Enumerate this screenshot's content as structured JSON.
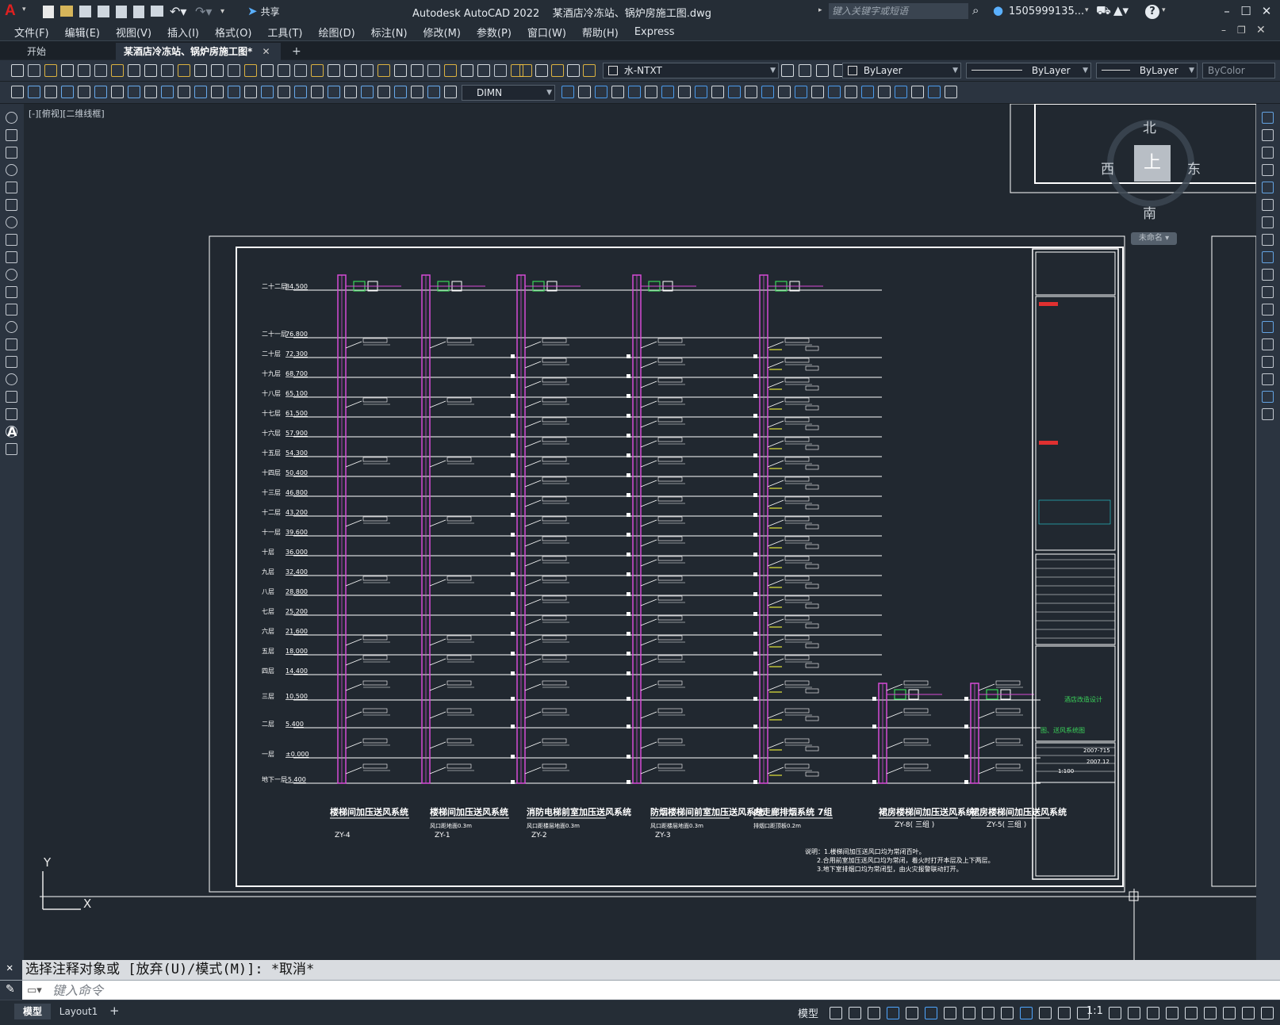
{
  "app": {
    "logo": "A",
    "share_label": "共享",
    "title": "Autodesk AutoCAD 2022    某酒店冷冻站、锅炉房施工图.dwg",
    "search_placeholder": "键入关键字或短语",
    "user": "1505999135...",
    "help": "?"
  },
  "menu": [
    "文件(F)",
    "编辑(E)",
    "视图(V)",
    "插入(I)",
    "格式(O)",
    "工具(T)",
    "绘图(D)",
    "标注(N)",
    "修改(M)",
    "参数(P)",
    "窗口(W)",
    "帮助(H)",
    "Express"
  ],
  "tabs": {
    "start": "开始",
    "active": "某酒店冷冻站、锅炉房施工图*",
    "close": "✕",
    "add": "+"
  },
  "toolbar": {
    "layer": "水-NTXT",
    "color": "ByLayer",
    "linetype": "ByLayer",
    "lineweight": "ByLayer",
    "plotstyle": "ByColor",
    "dimstyle": "DIMN"
  },
  "viewport": {
    "label": "[-][俯视][二维线框]"
  },
  "viewcube": {
    "north": "北",
    "south": "南",
    "east": "东",
    "west": "西",
    "top": "上",
    "wcs": "未命名"
  },
  "drawing": {
    "floors": [
      "二十二层",
      "二十一层",
      "二十层",
      "十九层",
      "十八层",
      "十七层",
      "十六层",
      "十五层",
      "十四层",
      "十三层",
      "十二层",
      "十一层",
      "十层",
      "九层",
      "八层",
      "七层",
      "六层",
      "五层",
      "四层",
      "三层",
      "二层",
      "一层",
      "地下一层"
    ],
    "elevations": [
      "84.500",
      "76.800",
      "72.300",
      "68.700",
      "65.100",
      "61.500",
      "57.900",
      "54.300",
      "50.400",
      "46.800",
      "43.200",
      "39.600",
      "36.000",
      "32.400",
      "28.800",
      "25.200",
      "21.600",
      "18.000",
      "14.400",
      "10.500",
      "5.400",
      "±0.000",
      "-5.400"
    ],
    "systems": [
      {
        "title": "楼梯间加压送风系统",
        "code": "ZY-4",
        "sub": ""
      },
      {
        "title": "楼梯间加压送风系统",
        "code": "ZY-1",
        "sub": "风口距地面0.3m"
      },
      {
        "title": "消防电梯前室加压送风系统",
        "code": "ZY-2",
        "sub": "风口距楼层地面0.3m"
      },
      {
        "title": "防烟楼梯间前室加压送风系统",
        "code": "ZY-3",
        "sub": "风口距楼层地面0.3m"
      },
      {
        "title": "内走廊排烟系统 7组",
        "code": "",
        "sub": "排烟口距顶板0.2m"
      },
      {
        "title": "裙房楼梯间加压送风系统",
        "code": "ZY-8( 三组 )",
        "sub": ""
      },
      {
        "title": "裙房楼梯间加压送风系统",
        "code": "ZY-5( 三组 )",
        "sub": ""
      }
    ],
    "notes": [
      "说明：1.楼梯间加压送风口均为常闭百叶。",
      "2.合用前室加压送风口均为常闭，着火时打开本层及上下两层。",
      "3.地下室排烟口均为常闭型，由火灾报警联动打开。"
    ],
    "titleblock": {
      "project": "酒店改造设计",
      "drawing": "图、送风系统图",
      "no": "2007-715",
      "scale": "1:100",
      "date": "2007.12"
    }
  },
  "command": {
    "history": "选择注释对象或 [放弃(U)/模式(M)]: *取消*",
    "placeholder": "键入命令"
  },
  "status": {
    "model_tab": "模型",
    "layout_tab": "Layout1",
    "add": "+",
    "model": "模型",
    "scale": "1:1"
  }
}
